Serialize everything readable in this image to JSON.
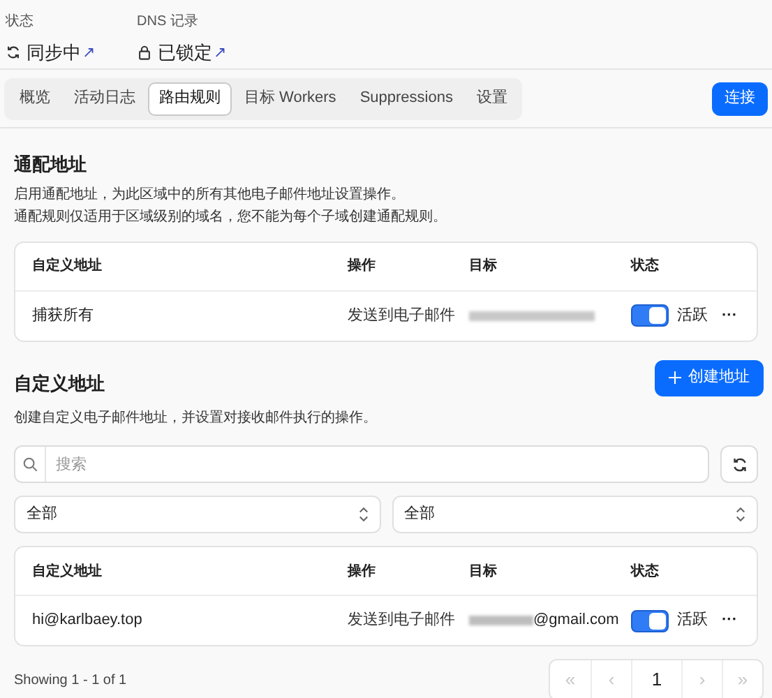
{
  "status_items": [
    {
      "label": "状态",
      "kind": "sync",
      "value": "同步中",
      "link_icon": "↗"
    },
    {
      "label": "DNS 记录",
      "kind": "lock",
      "value": "已锁定",
      "link_icon": "↗"
    }
  ],
  "tabs": [
    {
      "label": "概览",
      "selected": false
    },
    {
      "label": "活动日志",
      "selected": false
    },
    {
      "label": "路由规则",
      "selected": true
    },
    {
      "label": "目标 Workers",
      "selected": false
    },
    {
      "label": "Suppressions",
      "selected": false
    },
    {
      "label": "设置",
      "selected": false
    }
  ],
  "connect_button": "连接",
  "catch_all": {
    "title": "通配地址",
    "description": [
      "启用通配地址，为此区域中的所有其他电子邮件地址设置操作。",
      "通配规则仅适用于区域级别的域名，您不能为每个子域创建通配规则。"
    ],
    "columns": [
      "自定义地址",
      "操作",
      "目标",
      "状态"
    ],
    "rows": [
      {
        "address": "捕获所有",
        "action": "发送到电子邮件",
        "target_redacted": true,
        "target_suffix": "",
        "on": true,
        "status": "活跃",
        "menu": "···"
      }
    ]
  },
  "custom": {
    "title": "自定义地址",
    "description": "创建自定义电子邮件地址，并设置对接收邮件执行的操作。",
    "create_button": "创建地址",
    "search": {
      "placeholder": "搜索"
    },
    "filters": [
      {
        "value": "全部"
      },
      {
        "value": "全部"
      }
    ],
    "columns": [
      "自定义地址",
      "操作",
      "目标",
      "状态"
    ],
    "rows": [
      {
        "address": "hi@karlbaey.top",
        "action": "发送到电子邮件",
        "target_redacted": true,
        "target_suffix": "@gmail.com",
        "on": true,
        "status": "活跃",
        "menu": "···"
      }
    ],
    "showing": "Showing 1 - 1 of 1",
    "pagination": [
      {
        "label": "«",
        "kind": "first",
        "disabled": true
      },
      {
        "label": "‹",
        "kind": "prev",
        "disabled": true
      },
      {
        "label": "1",
        "kind": "page",
        "disabled": false
      },
      {
        "label": "›",
        "kind": "next",
        "disabled": true
      },
      {
        "label": "»",
        "kind": "last",
        "disabled": true
      }
    ]
  }
}
